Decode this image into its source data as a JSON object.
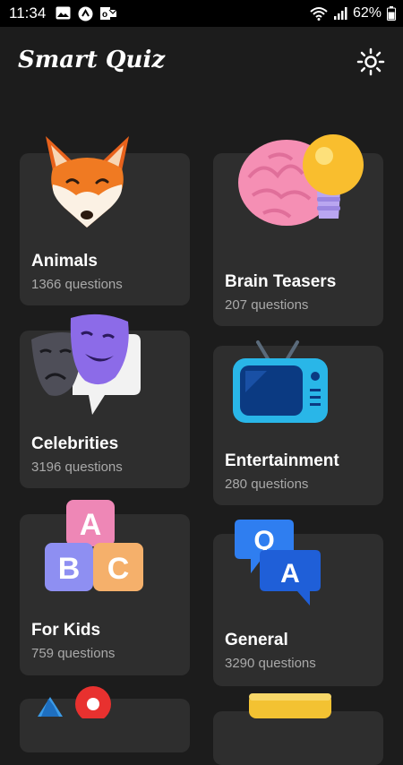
{
  "status_bar": {
    "time": "11:34",
    "battery": "62%",
    "left_icons": [
      "image-icon",
      "android-icon",
      "outlook-icon"
    ],
    "right_icons": [
      "wifi-icon",
      "signal-icon",
      "battery-icon"
    ]
  },
  "app_bar": {
    "title": "Smart Quiz",
    "theme_icon": "sun-icon"
  },
  "categories": [
    {
      "name": "Animals",
      "count": "1366 questions",
      "icon": "fox-icon"
    },
    {
      "name": "Brain Teasers",
      "count": "207 questions",
      "icon": "brain-lightbulb-icon"
    },
    {
      "name": "Celebrities",
      "count": "3196 questions",
      "icon": "theater-masks-icon"
    },
    {
      "name": "Entertainment",
      "count": "280 questions",
      "icon": "tv-icon"
    },
    {
      "name": "For Kids",
      "count": "759 questions",
      "icon": "abc-blocks-icon"
    },
    {
      "name": "General",
      "count": "3290 questions",
      "icon": "qa-bubbles-icon"
    }
  ],
  "colors": {
    "background": "#1c1c1c",
    "card": "#2e2e2e",
    "status_bar": "#000000",
    "secondary_text": "#a9a9a9"
  }
}
